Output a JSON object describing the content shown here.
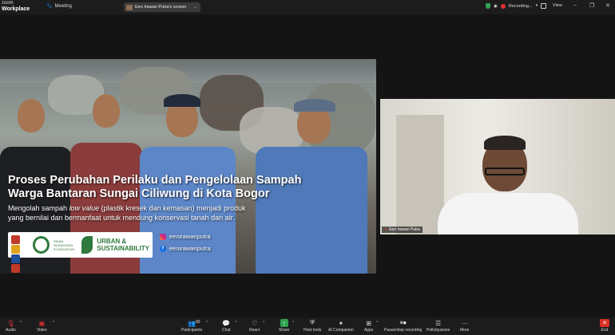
{
  "app": {
    "logo_line1": "zoom",
    "logo_line2": "Workplace"
  },
  "topbar": {
    "meeting_label": "Meeting",
    "screen_label": "Een Irawan Putra's screen",
    "recording_label": "Recording...",
    "view_label": "View"
  },
  "slide": {
    "title_line1": "Proses Perubahan Perilaku dan Pengelolaan Sampah",
    "title_line2": "Warga Bantaran Sungai Ciliwung di Kota Bogor",
    "sub_a": "Mengolah sampah ",
    "sub_em": "low value",
    "sub_b": " (plastik kresek dan kemasan) menjadi produk",
    "sub_line2": "yang bernilai dan bermanfaat untuk mendung konservasi tanah dan air.",
    "rn_text": "RIKAN NUSANTARA FOUNDATION",
    "us_text_1": "URBAN &",
    "us_text_2": "SUSTAINABILITY",
    "instagram": "eenirawanputra",
    "facebook": "eenirawanputra",
    "fb_glyph": "f"
  },
  "participant": {
    "name": "Een Irawan Putra"
  },
  "toolbar": {
    "audio": "Audio",
    "video": "Video",
    "participants": "Participants",
    "participants_count": "89",
    "chat": "Chat",
    "react": "React",
    "share": "Share",
    "host_tools": "Host tools",
    "ai_companion": "AI Companion",
    "apps": "Apps",
    "pause_recording": "Pause/stop recording",
    "polls": "Polls/quizzes",
    "more": "More",
    "end": "End"
  },
  "icons": {
    "meeting": "paw-icon",
    "shield": "shield-check-icon",
    "audio": "mic-off-icon",
    "video": "video-off-icon",
    "participants": "people-icon",
    "chat": "chat-icon",
    "react": "heart-icon",
    "share": "share-up-icon",
    "host_tools": "shield-icon",
    "ai_companion": "sparkle-icon",
    "apps": "apps-icon",
    "pause": "pause-stop-icon",
    "polls": "polls-icon",
    "more": "more-icon",
    "end": "close-icon"
  },
  "colors": {
    "record": "#e03131",
    "shield": "#2ea44f",
    "end": "#d93025",
    "share": "#2ea44f",
    "brand_green": "#2f7a3c"
  }
}
